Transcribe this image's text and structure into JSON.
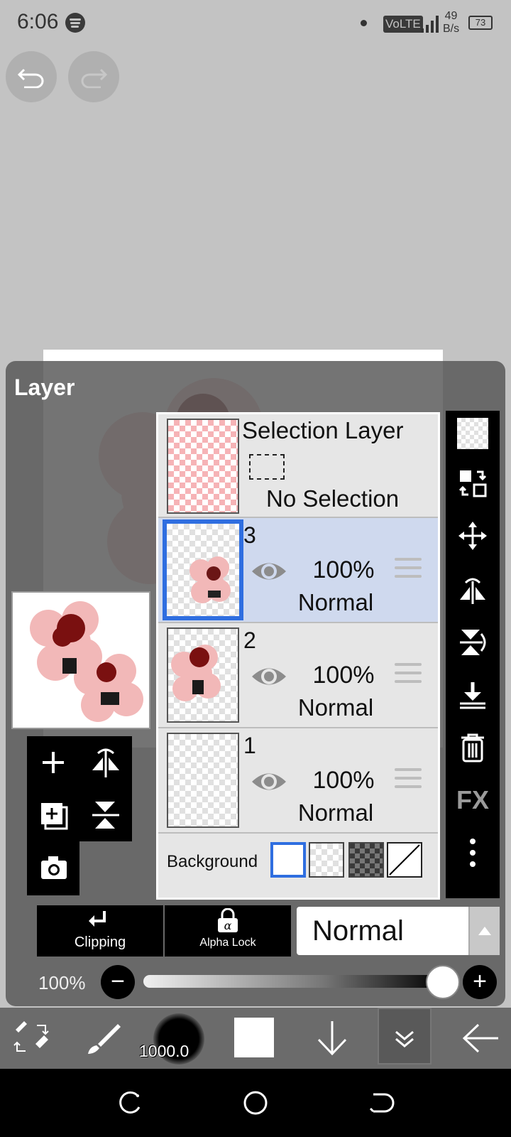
{
  "status_bar": {
    "time": "6:06",
    "network_label": "VoLTE",
    "net_speed_value": "49",
    "net_speed_unit": "B/s",
    "battery": "73",
    "icons": [
      "spotify-icon",
      "dot-icon",
      "signal-icon",
      "battery-icon"
    ]
  },
  "panel": {
    "title": "Layer"
  },
  "selection_layer": {
    "title": "Selection Layer",
    "status": "No Selection"
  },
  "layers": [
    {
      "number": "3",
      "opacity": "100%",
      "blend": "Normal",
      "selected": true
    },
    {
      "number": "2",
      "opacity": "100%",
      "blend": "Normal",
      "selected": false
    },
    {
      "number": "1",
      "opacity": "100%",
      "blend": "Normal",
      "selected": false
    }
  ],
  "background": {
    "label": "Background",
    "options": [
      "white",
      "transparent",
      "dark-checker",
      "none"
    ],
    "selected": "white"
  },
  "right_toolbar": {
    "fx_label": "FX",
    "icons": [
      "checkerboard-icon",
      "swap-layer-icon",
      "move-icon",
      "flip-horizontal-icon",
      "flip-vertical-icon",
      "merge-down-icon",
      "trash-icon",
      "fx-icon",
      "more-icon"
    ]
  },
  "left_tools": {
    "icons": [
      "add-layer-icon",
      "flip-icon",
      "add-folder-icon",
      "rotate-flip-icon",
      "camera-icon"
    ]
  },
  "controls": {
    "clipping_label": "Clipping",
    "alpha_lock_label": "Alpha Lock",
    "blend_mode": "Normal",
    "opacity_label": "100%",
    "opacity_value": 1.0
  },
  "bottom_toolbar": {
    "brush_size": "1000.0",
    "color": "#ffffff",
    "icons": [
      "transform-icon",
      "brush-icon",
      "brush-size-icon",
      "color-swatch-icon",
      "arrow-down-icon",
      "double-chevron-down-icon",
      "back-arrow-icon"
    ]
  },
  "colors": {
    "accent": "#2f6ee0",
    "selected_row": "#cfd9ee",
    "panel": "#555555"
  }
}
